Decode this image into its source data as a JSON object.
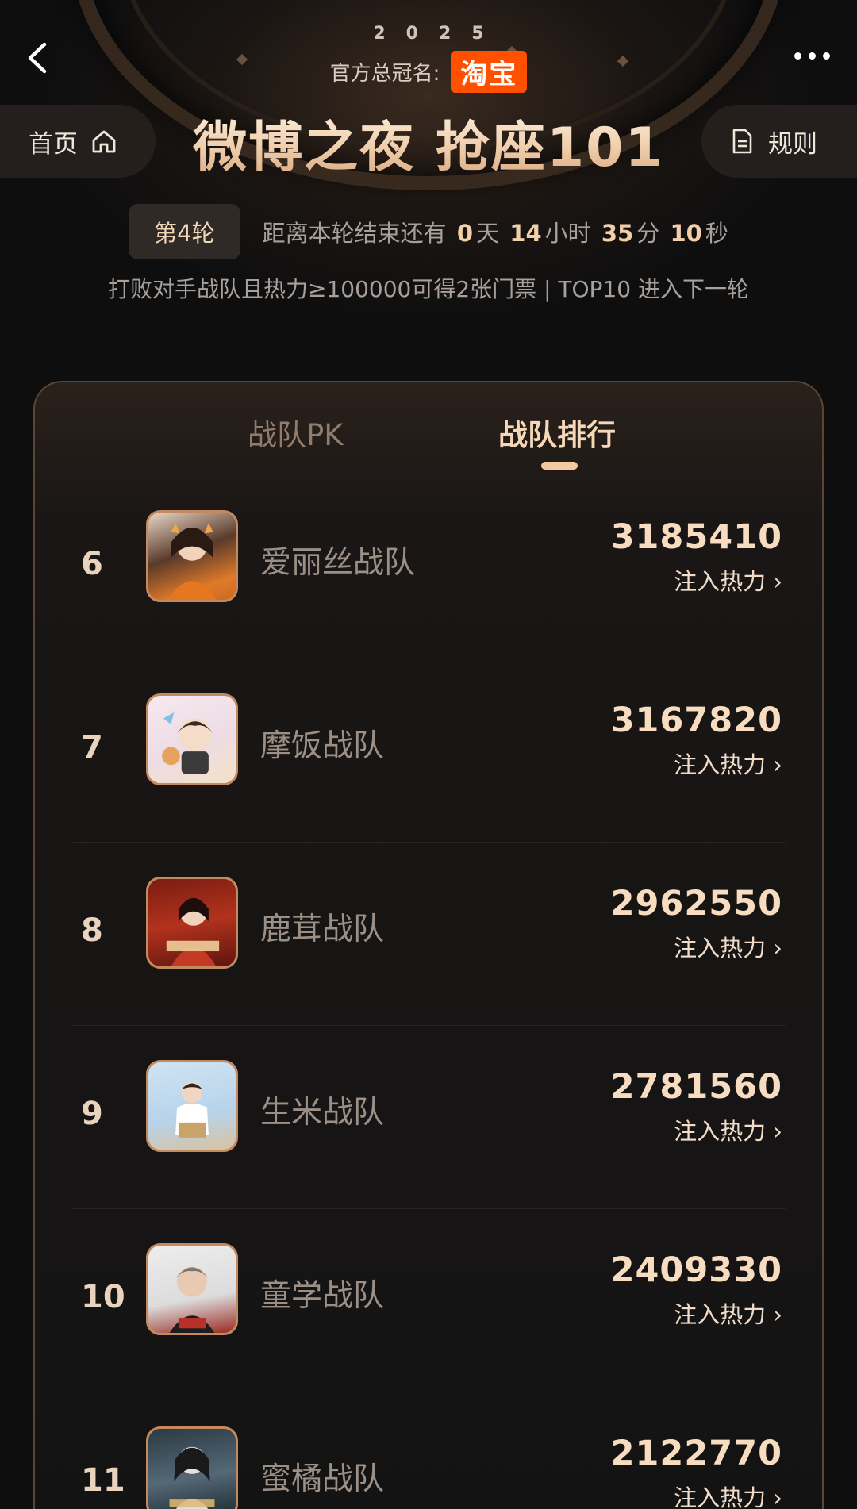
{
  "header": {
    "year": "2025",
    "sponsor_label": "官方总冠名:",
    "sponsor_name": "淘宝",
    "title": "微博之夜 抢座101",
    "home_label": "首页",
    "rules_label": "规则"
  },
  "round": {
    "badge": "第4轮",
    "countdown_prefix": "距离本轮结束还有",
    "days": "0",
    "days_unit": "天",
    "hours": "14",
    "hours_unit": "小时",
    "minutes": "35",
    "minutes_unit": "分",
    "seconds": "10",
    "seconds_unit": "秒",
    "rule_text": "打败对手战队且热力≥100000可得2张门票 | TOP10 进入下一轮"
  },
  "tabs": {
    "pk": "战队PK",
    "ranking": "战队排行",
    "active": "ranking"
  },
  "teams": [
    {
      "rank": "6",
      "name": "爱丽丝战队",
      "score": "3185410",
      "action": "注入热力 ›"
    },
    {
      "rank": "7",
      "name": "摩饭战队",
      "score": "3167820",
      "action": "注入热力 ›"
    },
    {
      "rank": "8",
      "name": "鹿茸战队",
      "score": "2962550",
      "action": "注入热力 ›"
    },
    {
      "rank": "9",
      "name": "生米战队",
      "score": "2781560",
      "action": "注入热力 ›"
    },
    {
      "rank": "10",
      "name": "童学战队",
      "score": "2409330",
      "action": "注入热力 ›"
    },
    {
      "rank": "11",
      "name": "蜜橘战队",
      "score": "2122770",
      "action": "注入热力 ›"
    }
  ],
  "colors": {
    "accent": "#f3cfa8",
    "sponsor": "#ff5000",
    "background": "#0e0e0f"
  }
}
